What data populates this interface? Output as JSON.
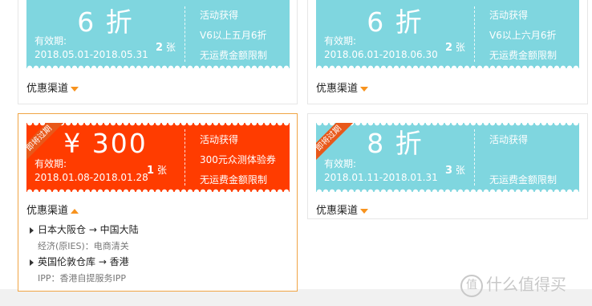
{
  "coupons": [
    {
      "amount": "6 折",
      "validity_label": "有效期:",
      "dates": "2018.05.01-2018.05.31",
      "count": "2",
      "count_unit": "张",
      "source": "活动获得",
      "condition": "V6以上五月6折",
      "shipping": "无运费金额限制",
      "channel_label": "优惠渠道",
      "color": "#7fd6df"
    },
    {
      "amount": "6 折",
      "validity_label": "有效期:",
      "dates": "2018.06.01-2018.06.30",
      "count": "2",
      "count_unit": "张",
      "source": "活动获得",
      "condition": "V6以上六月6折",
      "shipping": "无运费金额限制",
      "channel_label": "优惠渠道",
      "color": "#7fd6df"
    },
    {
      "amount": "¥ 300",
      "validity_label": "有效期:",
      "dates": "2018.01.08-2018.01.28",
      "count": "1",
      "count_unit": "张",
      "source": "活动获得",
      "condition": "300元众测体验券",
      "shipping": "无运费金额限制",
      "channel_label": "优惠渠道",
      "ribbon": "即将过期",
      "color": "#ff3c00"
    },
    {
      "amount": "8 折",
      "validity_label": "有效期:",
      "dates": "2018.01.11-2018.01.31",
      "count": "3",
      "count_unit": "张",
      "source": "活动获得",
      "condition": "",
      "shipping": "无运费金额限制",
      "channel_label": "优惠渠道",
      "ribbon": "即将过期",
      "color": "#7fd6df"
    }
  ],
  "routes": [
    {
      "path": "日本大阪仓 → 中国大陆",
      "service": "经济(原IES)：电商清关"
    },
    {
      "path": "英国伦敦仓库 → 香港",
      "service": "IPP：香港自提服务IPP"
    }
  ],
  "watermark": "什么值得买",
  "watermark_icon": "值"
}
